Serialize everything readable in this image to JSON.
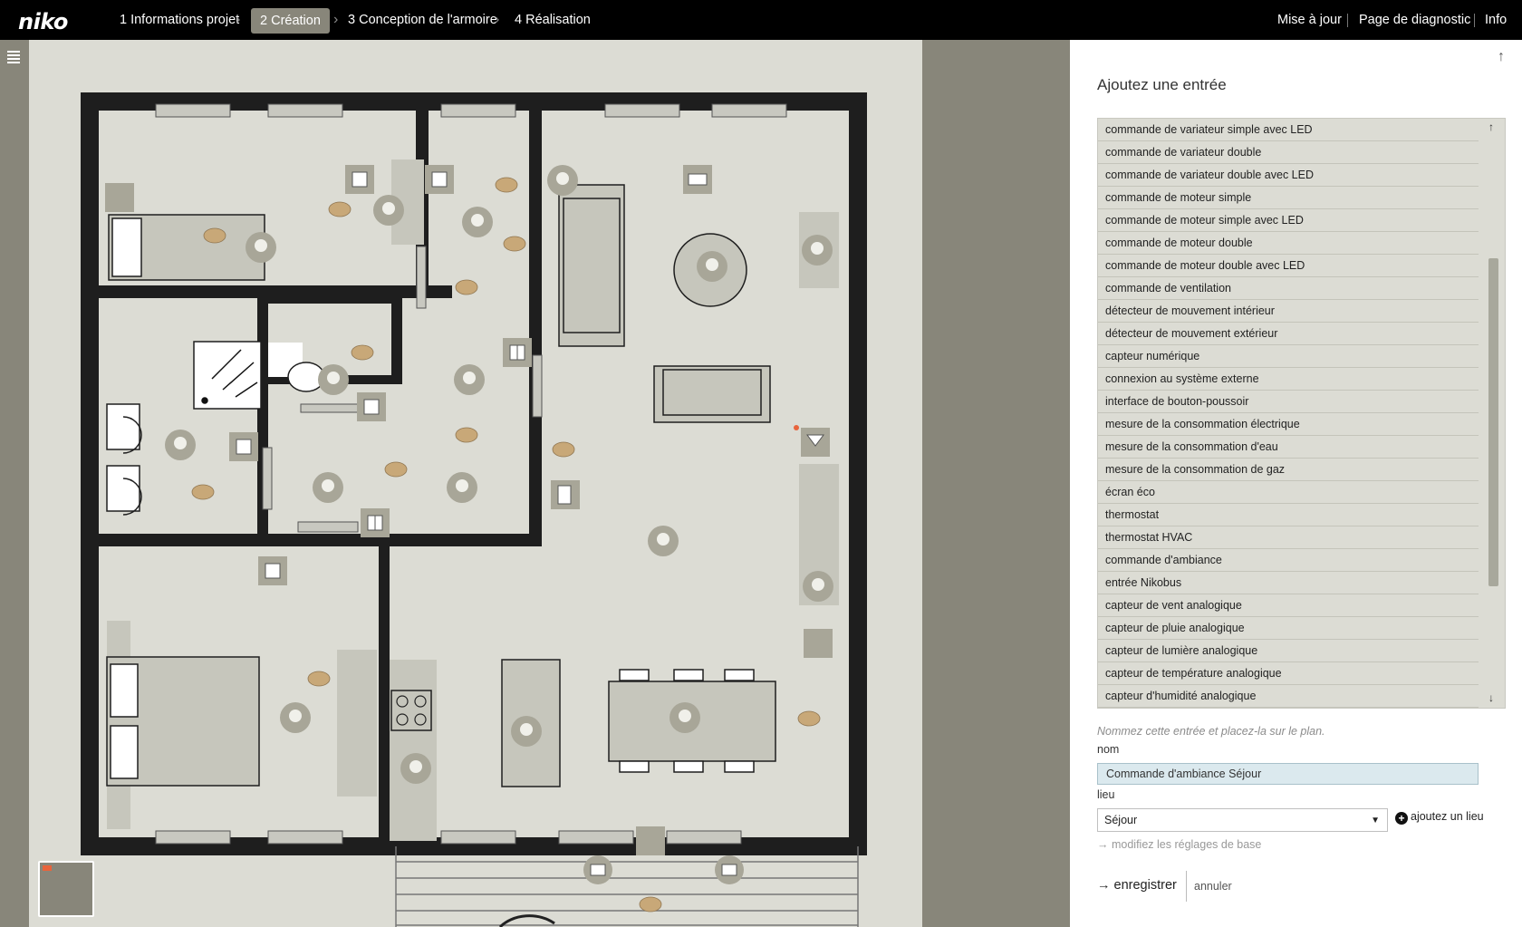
{
  "app": {
    "logo": "niko"
  },
  "steps": [
    {
      "label": "1 Informations projet"
    },
    {
      "label": "2 Création"
    },
    {
      "label": "3 Conception de l'armoire"
    },
    {
      "label": "4 Réalisation"
    }
  ],
  "top_links": {
    "update": "Mise à jour",
    "diagnostic": "Page de diagnostic",
    "info": "Info"
  },
  "colors": {
    "topbar": "#000000",
    "accent": "#88867a",
    "canvas": "#dcdcd4",
    "lamp_marker": "#c8a878",
    "device_marker": "#a8a698",
    "input_bg": "#dbe9ee"
  },
  "panel": {
    "title": "Ajoutez une entrée",
    "items": [
      "commande de variateur simple avec LED",
      "commande de variateur double",
      "commande de variateur double avec LED",
      "commande de moteur simple",
      "commande de moteur simple avec LED",
      "commande de moteur double",
      "commande de moteur double avec LED",
      "commande de ventilation",
      "détecteur de mouvement intérieur",
      "détecteur de mouvement extérieur",
      "capteur numérique",
      "connexion au système externe",
      "interface de bouton-poussoir",
      "mesure de la consommation électrique",
      "mesure de la consommation d'eau",
      "mesure de la consommation de gaz",
      "écran éco",
      "thermostat",
      "thermostat HVAC",
      "commande d'ambiance",
      "entrée Nikobus",
      "capteur de vent analogique",
      "capteur de pluie analogique",
      "capteur de lumière analogique",
      "capteur de température analogique",
      "capteur d'humidité analogique"
    ],
    "hint": "Nommez cette entrée et placez-la sur le plan.",
    "name_label": "nom",
    "name_value": "Commande d'ambiance Séjour",
    "location_label": "lieu",
    "location_value": "Séjour",
    "add_location": "ajoutez un lieu",
    "base_settings": "modifiez les réglages de base",
    "save": "enregistrer",
    "cancel": "annuler"
  }
}
